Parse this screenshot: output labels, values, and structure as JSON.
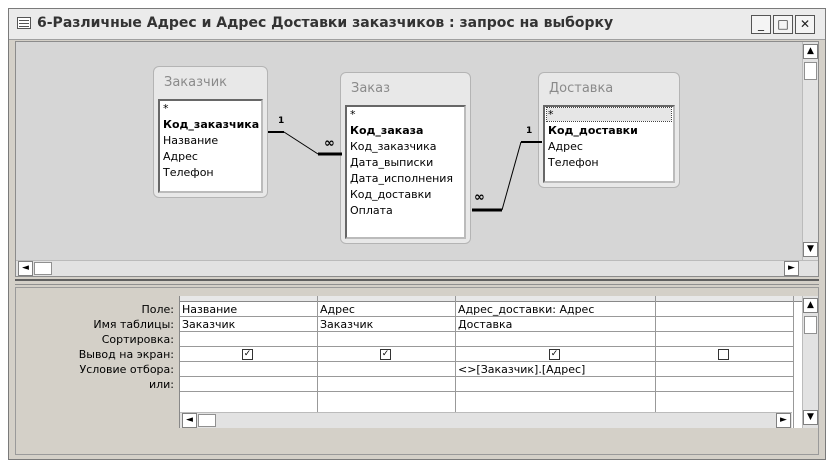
{
  "window": {
    "title": "6-Различные Адрес и Адрес Доставки заказчиков : запрос на выборку",
    "minimize_label": "_",
    "maximize_label": "□",
    "close_label": "✕"
  },
  "tables": [
    {
      "title": "Заказчик",
      "fields": [
        {
          "name": "*",
          "bold": false
        },
        {
          "name": "Код_заказчика",
          "bold": true
        },
        {
          "name": "Название",
          "bold": false
        },
        {
          "name": "Адрес",
          "bold": false
        },
        {
          "name": "Телефон",
          "bold": false
        }
      ]
    },
    {
      "title": "Заказ",
      "fields": [
        {
          "name": "*",
          "bold": false
        },
        {
          "name": "Код_заказа",
          "bold": true
        },
        {
          "name": "Код_заказчика",
          "bold": false
        },
        {
          "name": "Дата_выписки",
          "bold": false
        },
        {
          "name": "Дата_исполнения",
          "bold": false
        },
        {
          "name": "Код_доставки",
          "bold": false
        },
        {
          "name": "Оплата",
          "bold": false
        }
      ]
    },
    {
      "title": "Доставка",
      "fields": [
        {
          "name": "*",
          "bold": false,
          "selected": true
        },
        {
          "name": "Код_доставки",
          "bold": true
        },
        {
          "name": "Адрес",
          "bold": false
        },
        {
          "name": "Телефон",
          "bold": false
        }
      ]
    }
  ],
  "relationships": [
    {
      "one": "1",
      "many": "∞"
    },
    {
      "one": "1",
      "many": "∞"
    }
  ],
  "grid": {
    "row_labels": [
      "Поле:",
      "Имя таблицы:",
      "Сортировка:",
      "Вывод на экран:",
      "Условие отбора:",
      "или:"
    ],
    "columns": [
      {
        "field": "Название",
        "table": "Заказчик",
        "sort": "",
        "show": true,
        "criteria": "",
        "or": ""
      },
      {
        "field": "Адрес",
        "table": "Заказчик",
        "sort": "",
        "show": true,
        "criteria": "",
        "or": ""
      },
      {
        "field": "Адрес_доставки: Адрес",
        "table": "Доставка",
        "sort": "",
        "show": true,
        "criteria": "<>[Заказчик].[Адрес]",
        "or": ""
      },
      {
        "field": "",
        "table": "",
        "sort": "",
        "show": false,
        "criteria": "",
        "or": ""
      }
    ]
  },
  "scroll": {
    "up_arrow": "▲",
    "down_arrow": "▼",
    "left_arrow": "◄",
    "right_arrow": "►"
  }
}
